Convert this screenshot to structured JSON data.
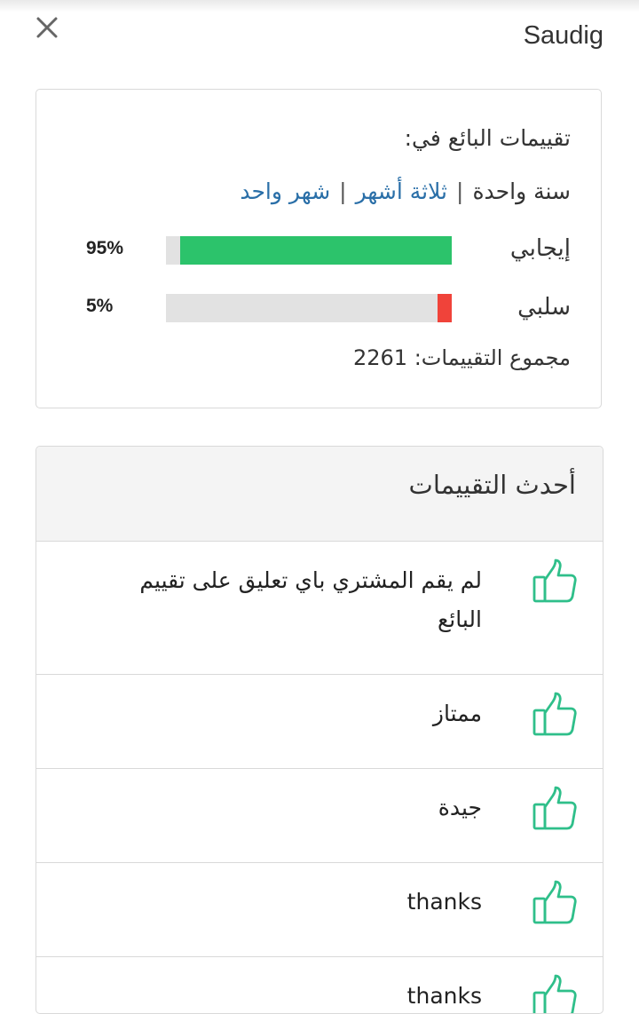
{
  "header": {
    "seller_name": "Saudig",
    "close_icon": "close-icon"
  },
  "summary": {
    "heading": "تقييمات البائع في:",
    "periods": [
      {
        "label": "سنة واحدة",
        "active": true
      },
      {
        "label": "ثلاثة أشهر",
        "active": false
      },
      {
        "label": "شهر واحد",
        "active": false
      }
    ],
    "positive": {
      "label": "إيجابي",
      "percent_text": "95%",
      "fraction": 0.95,
      "color": "#2cc36b"
    },
    "negative": {
      "label": "سلبي",
      "percent_text": "5%",
      "fraction": 0.05,
      "color": "#f0433a"
    },
    "total_label": "مجموع التقييمات:",
    "total_value": "2261"
  },
  "reviews": {
    "title": "أحدث التقييمات",
    "icon": "thumbs-up-icon",
    "icon_color": "#2fbf8a",
    "items": [
      {
        "text": "لم يقم المشتري باي تعليق على تقييم البائع"
      },
      {
        "text": "ممتاز"
      },
      {
        "text": "جيدة"
      },
      {
        "text": "thanks"
      },
      {
        "text": "thanks"
      }
    ]
  }
}
